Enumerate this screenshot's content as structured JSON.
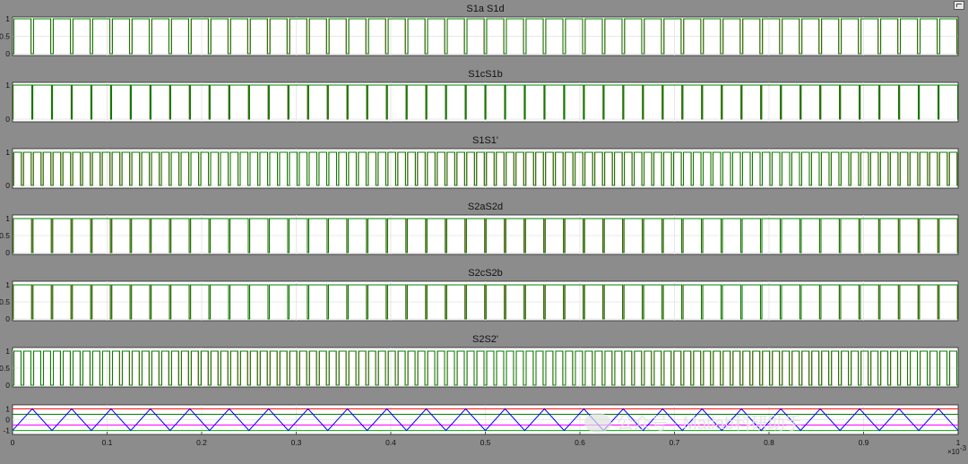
{
  "chart_data": [
    {
      "type": "line",
      "title": "S1a S1d",
      "xlim": [
        0,
        0.001
      ],
      "ylim": [
        0,
        1
      ],
      "yticks": [
        "0",
        "0.5",
        "1"
      ],
      "signals": [
        {
          "color": "#ff0000",
          "pulses": 48,
          "duty": 0.87,
          "phase": 0.0,
          "initial": 0
        },
        {
          "color": "#008000",
          "pulses": 48,
          "duty": 0.87,
          "phase": 0.005,
          "initial": 0
        }
      ]
    },
    {
      "type": "line",
      "title": "S1cS1b",
      "xlim": [
        0,
        0.001
      ],
      "ylim": [
        0,
        1
      ],
      "yticks": [
        "0",
        "1"
      ],
      "signals": [
        {
          "color": "#ff0000",
          "pulses": 48,
          "duty": 0.95,
          "phase": 0.0,
          "initial": 0
        },
        {
          "color": "#008000",
          "pulses": 48,
          "duty": 0.95,
          "phase": 0.004,
          "initial": 0
        }
      ]
    },
    {
      "type": "line",
      "title": "S1S1'",
      "xlim": [
        0,
        0.001
      ],
      "ylim": [
        0,
        1
      ],
      "yticks": [
        "0",
        "1"
      ],
      "signals": [
        {
          "color": "#ff0000",
          "pulses": 96,
          "duty": 0.78,
          "phase": 0.0,
          "initial": 0
        },
        {
          "color": "#008000",
          "pulses": 96,
          "duty": 0.78,
          "phase": 0.006,
          "initial": 0
        }
      ]
    },
    {
      "type": "line",
      "title": "S2aS2d",
      "xlim": [
        0,
        0.001
      ],
      "ylim": [
        0,
        1
      ],
      "yticks": [
        "0",
        "0.5",
        "1"
      ],
      "signals": [
        {
          "color": "#ff0000",
          "pulses": 48,
          "duty": 0.93,
          "phase": 0.0,
          "initial": 0
        },
        {
          "color": "#008000",
          "pulses": 48,
          "duty": 0.93,
          "phase": 0.004,
          "initial": 0
        }
      ]
    },
    {
      "type": "line",
      "title": "S2cS2b",
      "xlim": [
        0,
        0.001
      ],
      "ylim": [
        0,
        1
      ],
      "yticks": [
        "0",
        "0.5",
        "1"
      ],
      "signals": [
        {
          "color": "#ff0000",
          "pulses": 48,
          "duty": 0.93,
          "phase": 0.0,
          "initial": 0
        },
        {
          "color": "#008000",
          "pulses": 48,
          "duty": 0.93,
          "phase": 0.003,
          "initial": 0
        }
      ]
    },
    {
      "type": "line",
      "title": "S2S2'",
      "xlim": [
        0,
        0.001
      ],
      "ylim": [
        0,
        1
      ],
      "yticks": [
        "0",
        "0.5",
        "1"
      ],
      "signals": [
        {
          "color": "#ff0000",
          "pulses": 96,
          "duty": 0.72,
          "phase": 0.0,
          "initial": 0
        },
        {
          "color": "#008000",
          "pulses": 96,
          "duty": 0.72,
          "phase": 0.005,
          "initial": 0
        }
      ]
    },
    {
      "type": "line",
      "title": "",
      "xlim": [
        0,
        0.001
      ],
      "ylim": [
        -1.2,
        1.2
      ],
      "yticks": [
        "-1",
        "0",
        "1"
      ],
      "xticks": [
        "0",
        "0.1",
        "0.2",
        "0.3",
        "0.4",
        "0.5",
        "0.6",
        "0.7",
        "0.8",
        "0.9",
        "1"
      ],
      "x_exponent": "×10",
      "x_exponent_power": "-3",
      "carrier": {
        "color": "#0000ff",
        "periods": 24,
        "min": -1,
        "max": 1
      },
      "references": [
        {
          "color": "#ff0000",
          "value": 1.0
        },
        {
          "color": "#008000",
          "value": 0.5
        },
        {
          "color": "#ff00ff",
          "value": -0.5
        },
        {
          "color": "#00aa00",
          "value": -1.0
        }
      ]
    }
  ],
  "watermark": "公众号 · Matlab科研助手"
}
